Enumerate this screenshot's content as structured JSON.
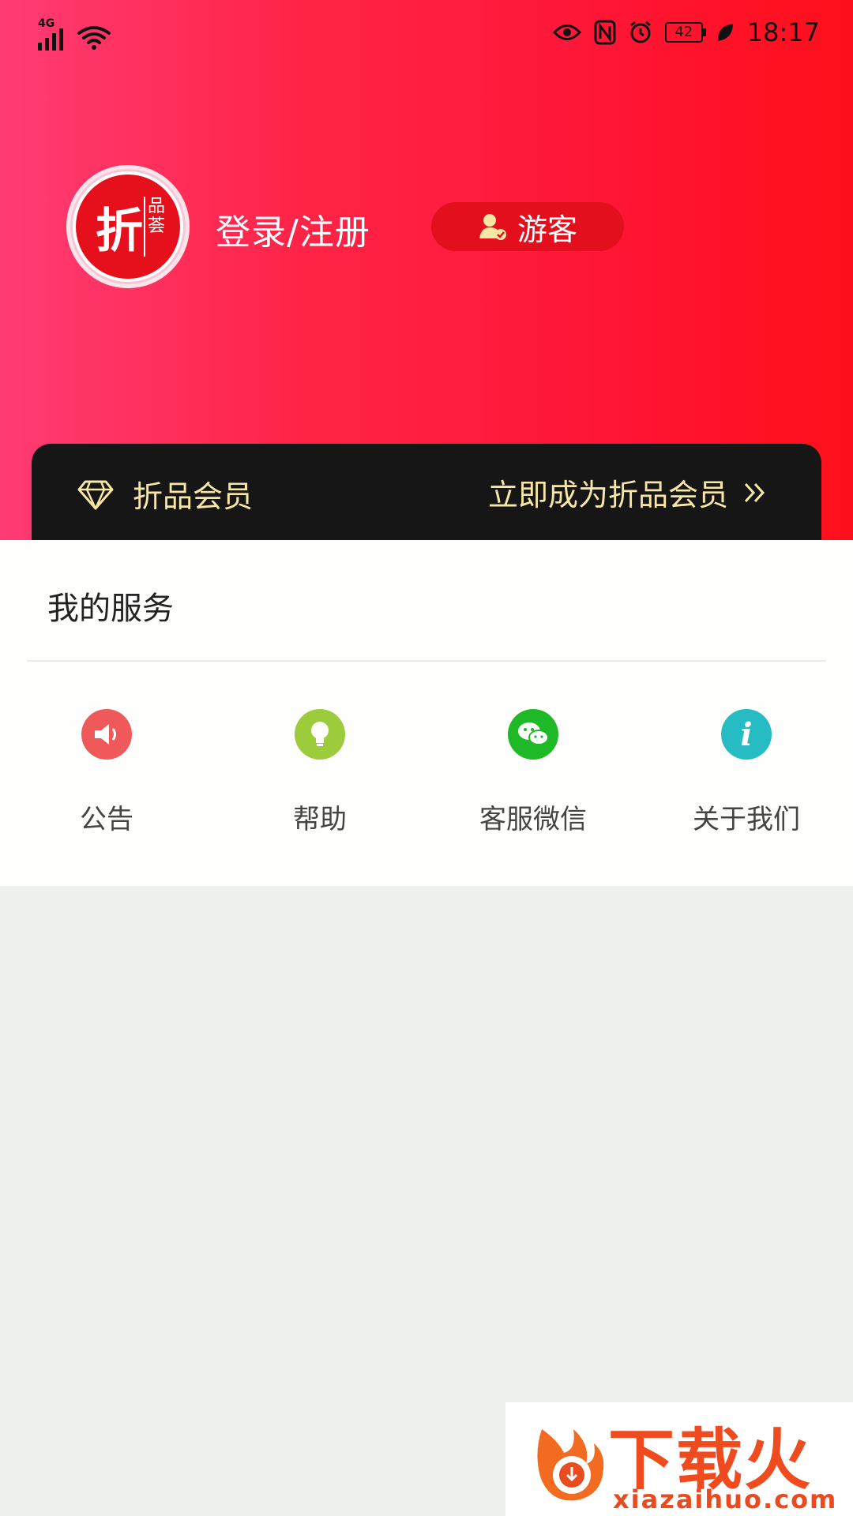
{
  "status_bar": {
    "network_type": "4G",
    "battery_level": "42",
    "time": "18:17",
    "icons": [
      "signal-icon",
      "wifi-icon",
      "eye-icon",
      "nfc-icon",
      "alarm-icon",
      "battery-icon",
      "leaf-icon"
    ]
  },
  "profile": {
    "avatar_main_char": "折",
    "avatar_side_chars": "品荟",
    "login_label": "登录/注册",
    "role_badge": "游客"
  },
  "member": {
    "title": "折品会员",
    "cta": "立即成为折品会员"
  },
  "services": {
    "title": "我的服务",
    "items": [
      {
        "label": "公告",
        "icon": "speaker-icon",
        "color": "#f0595a"
      },
      {
        "label": "帮助",
        "icon": "lightbulb-icon",
        "color": "#9ccb3b"
      },
      {
        "label": "客服微信",
        "icon": "wechat-icon",
        "color": "#1fb927"
      },
      {
        "label": "关于我们",
        "icon": "info-icon",
        "color": "#27bcc3"
      }
    ]
  },
  "watermark": {
    "brand": "下载火",
    "domain": "xiazaihuo.com"
  },
  "colors": {
    "header_start": "#ff3b74",
    "header_end": "#ff0f1a",
    "member_bar": "#161616",
    "member_text": "#f7e6a4",
    "page_bg": "#eef1ec"
  }
}
